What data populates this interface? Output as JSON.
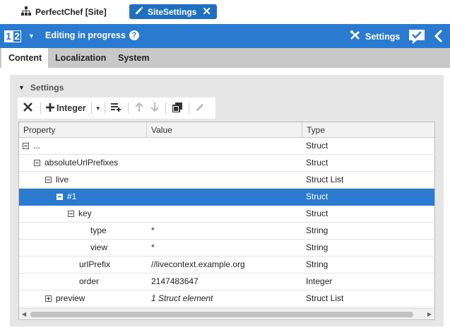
{
  "tabs": {
    "site": {
      "label": "PerfectChef [Site]",
      "icon": "sitemap-icon"
    },
    "active": {
      "label": "SiteSettings",
      "icon": "pencil-icon"
    }
  },
  "header": {
    "logo_a": "1",
    "logo_b": "2",
    "status": "Editing in progress",
    "settings_label": "Settings",
    "accent_color": "#2a7ad0"
  },
  "subtabs": [
    "Content",
    "Localization",
    "System"
  ],
  "panel": {
    "title": "Settings",
    "toolbar": {
      "add_label": "Integer"
    }
  },
  "grid": {
    "columns": [
      "Property",
      "Value",
      "Type"
    ],
    "rows": [
      {
        "property": "...",
        "value": "",
        "type": "Struct",
        "level": 0,
        "expander": "minus"
      },
      {
        "property": "absoluteUrlPrefixes",
        "value": "",
        "type": "Struct",
        "level": 1,
        "expander": "minus"
      },
      {
        "property": "live",
        "value": "",
        "type": "Struct List",
        "level": 2,
        "expander": "minus"
      },
      {
        "property": "#1",
        "value": "",
        "type": "Struct",
        "level": 3,
        "expander": "minus",
        "selected": true
      },
      {
        "property": "key",
        "value": "",
        "type": "Struct",
        "level": 4,
        "expander": "minus"
      },
      {
        "property": "type",
        "value": "*",
        "type": "String",
        "level": 6,
        "expander": "none"
      },
      {
        "property": "view",
        "value": "*",
        "type": "String",
        "level": 6,
        "expander": "none"
      },
      {
        "property": "urlPrefix",
        "value": "//livecontext.example.org",
        "type": "String",
        "level": 5,
        "expander": "none"
      },
      {
        "property": "order",
        "value": "2147483647",
        "type": "Integer",
        "level": 5,
        "expander": "none"
      },
      {
        "property": "preview",
        "value": "1 Struct element",
        "type": "Struct List",
        "level": 2,
        "expander": "plus",
        "italic_value": true
      }
    ]
  }
}
